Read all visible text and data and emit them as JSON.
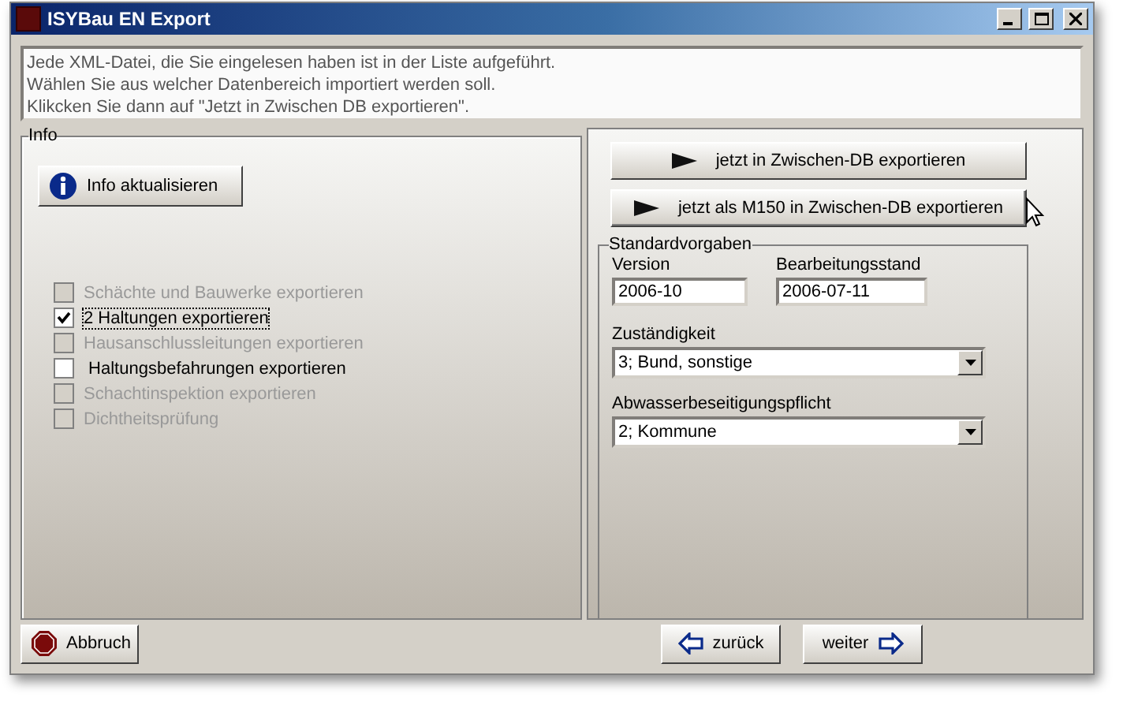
{
  "window": {
    "title": "ISYBau EN Export"
  },
  "intro": [
    "Jede XML-Datei, die Sie eingelesen haben ist in der Liste aufgeführt.",
    "Wählen Sie aus welcher Datenbereich importiert werden soll.",
    "Klikcken Sie dann auf \"Jetzt in Zwischen DB exportieren\"."
  ],
  "info": {
    "legend": "Info",
    "refresh_button": "Info aktualisieren",
    "options": [
      {
        "label": "Schächte und Bauwerke exportieren",
        "checked": false,
        "disabled": true,
        "focused": false
      },
      {
        "label": "2 Haltungen exportieren",
        "checked": true,
        "disabled": false,
        "focused": true
      },
      {
        "label": "Hausanschlussleitungen exportieren",
        "checked": false,
        "disabled": true,
        "focused": false
      },
      {
        "label": " Haltungsbefahrungen exportieren",
        "checked": false,
        "disabled": false,
        "focused": false
      },
      {
        "label": "Schachtinspektion exportieren",
        "checked": false,
        "disabled": true,
        "focused": false
      },
      {
        "label": "Dichtheitsprüfung",
        "checked": false,
        "disabled": true,
        "focused": false
      }
    ]
  },
  "export_buttons": [
    {
      "label": "jetzt in Zwischen-DB exportieren",
      "hovered": false
    },
    {
      "label": "jetzt als M150 in Zwischen-DB exportieren",
      "hovered": true
    }
  ],
  "defaults": {
    "legend": "Standardvorgaben",
    "version_label": "Version",
    "version": "2006-10",
    "status_label": "Bearbeitungsstand",
    "status": "2006-07-11",
    "selects": [
      {
        "label": "Zuständigkeit",
        "value": "3; Bund, sonstige"
      },
      {
        "label": "Abwasserbeseitigungspflicht",
        "value": "2; Kommune"
      }
    ]
  },
  "footer": {
    "cancel": "Abbruch",
    "back": "zurück",
    "next": "weiter"
  }
}
